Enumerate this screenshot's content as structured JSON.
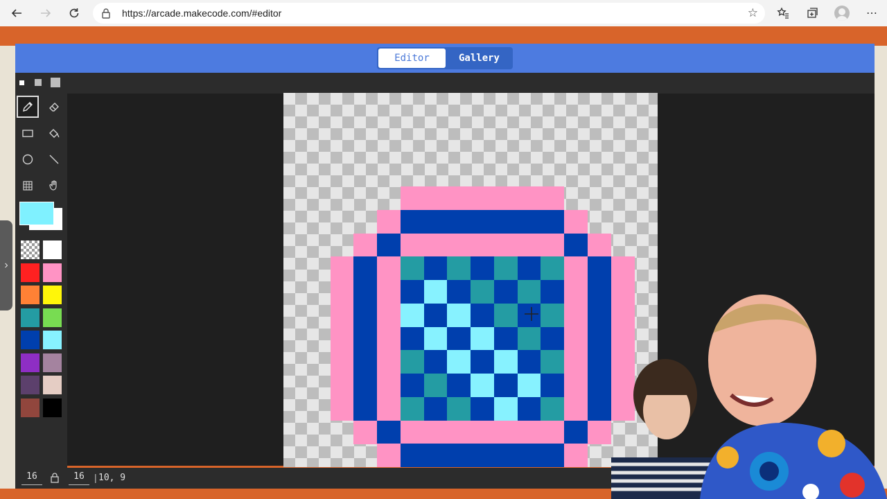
{
  "browser": {
    "url": "https://arcade.makecode.com/#editor",
    "back_icon": "back-arrow-icon",
    "forward_icon": "forward-arrow-icon",
    "reload_icon": "reload-icon"
  },
  "header": {
    "tabs": [
      {
        "label": "Editor",
        "selected": true
      },
      {
        "label": "Gallery",
        "selected": false
      }
    ]
  },
  "tools": [
    "pencil",
    "eraser",
    "rectangle",
    "fill",
    "circle",
    "line",
    "marquee",
    "pan"
  ],
  "selected_tool": "pencil",
  "brush_sizes": [
    "small",
    "medium",
    "large"
  ],
  "colors": {
    "primary": "#7ff1ff",
    "secondary": "#ffffff",
    "palette": [
      "transparent",
      "#ffffff",
      "#ff2121",
      "#ff93c4",
      "#ff8135",
      "#fff609",
      "#249ca3",
      "#78dc52",
      "#003fad",
      "#87f2ff",
      "#8e2ec4",
      "#a4839f",
      "#5c406c",
      "#e5cdc4",
      "#91463d",
      "#000000"
    ]
  },
  "image": {
    "width": "16",
    "height": "16",
    "cursor_position": "10, 9",
    "palette_keys": {
      ".": "transparent",
      "p": "#ff93c4",
      "b": "#003fad",
      "t": "#249ca3",
      "c": "#87f2ff"
    },
    "rows": [
      "................",
      "................",
      "................",
      "................",
      ".....ppppppp....",
      "....pbbbbbbbp...",
      "...pbpppppppbp..",
      "..pbptbtbtbtpbp.",
      "..pbpbcbtbtbpbp.",
      "..pbpcbcbtbtpbp.",
      "..pbpbcbcbtbpbp.",
      "..pbptbcbcbtpbp.",
      "..pbpbtbcbcbpbp.",
      "..pbptbtbcbtpbp.",
      "...pbpppppppbp..",
      "....pbbbbbbbp..."
    ]
  }
}
